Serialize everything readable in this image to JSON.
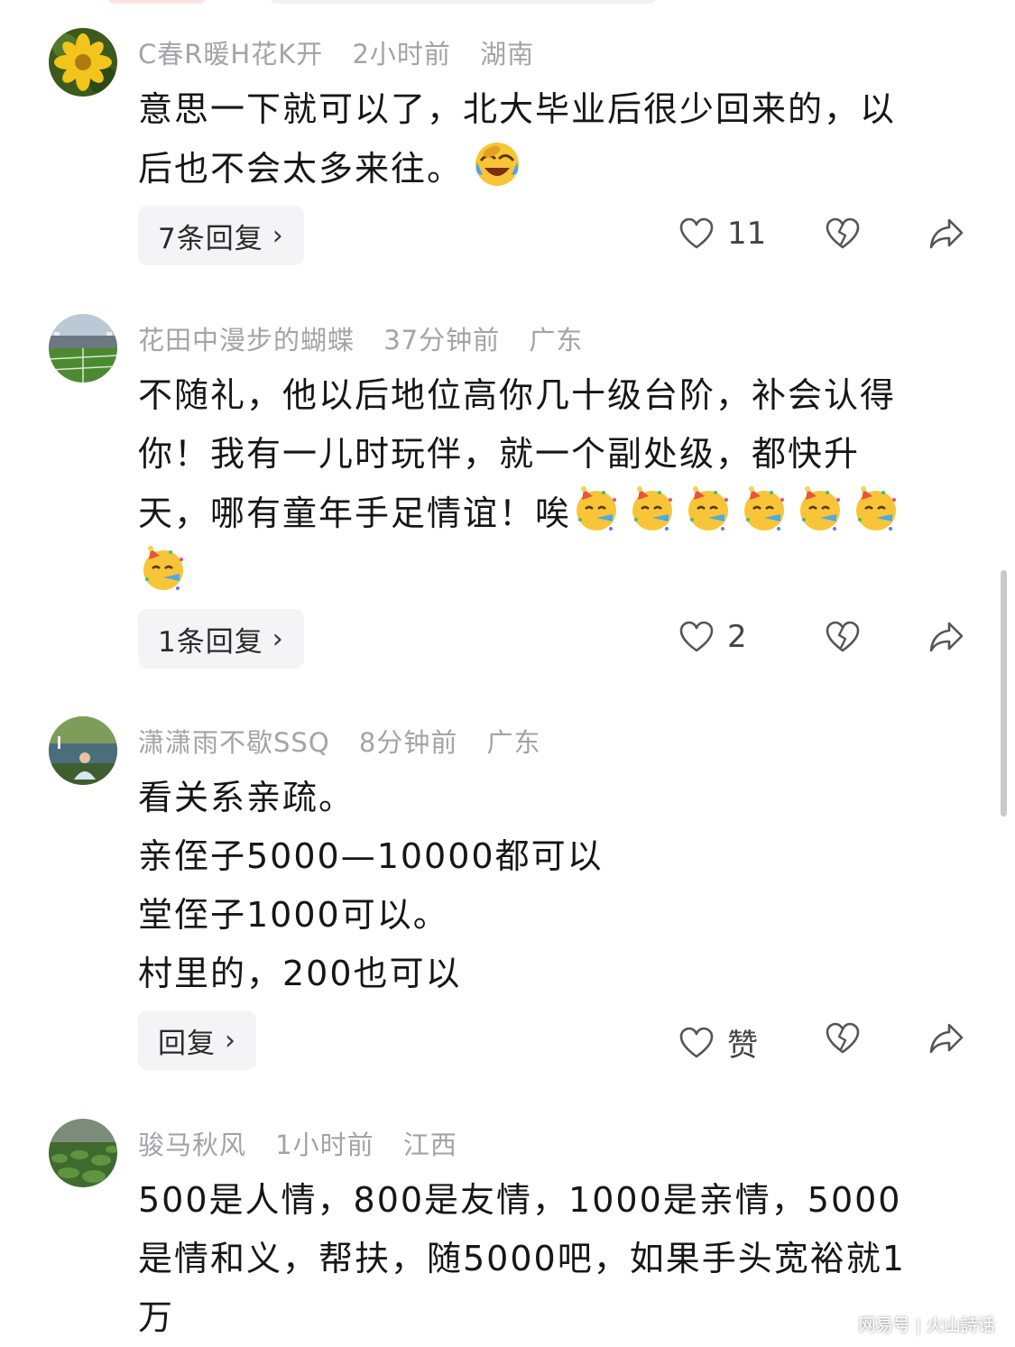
{
  "comments": [
    {
      "username": "C春R暖H花K开",
      "time": "2小时前",
      "location": "湖南",
      "lines": [
        "意思一下就可以了，北大毕业后很少回来的，以",
        "后也不会太多来往。"
      ],
      "reply_label": "7条回复",
      "like_count": "11",
      "avatar_icon": "flower-avatar",
      "emoji": "laughing-emoji"
    },
    {
      "username": "花田中漫步的蝴蝶",
      "time": "37分钟前",
      "location": "广东",
      "lines": [
        "不随礼，他以后地位高你几十级台阶，补会认得",
        "你！我有一儿时玩伴，就一个副处级，都快升",
        "天，哪有童年手足情谊！唉"
      ],
      "reply_label": "1条回复",
      "like_count": "2",
      "avatar_icon": "stadium-avatar",
      "emoji": "party-face-emoji"
    },
    {
      "username": "潇潇雨不歇SSQ",
      "time": "8分钟前",
      "location": "广东",
      "lines": [
        "看关系亲疏。",
        "亲侄子5000—10000都可以",
        "堂侄子1000可以。",
        "村里的，200也可以"
      ],
      "reply_label": "回复",
      "like_count": "赞",
      "avatar_icon": "man-lake-avatar"
    },
    {
      "username": "骏马秋风",
      "time": "1小时前",
      "location": "江西",
      "lines": [
        "500是人情，800是友情，1000是亲情，5000",
        "是情和义，帮扶，随5000吧，如果手头宽裕就1",
        "万"
      ],
      "avatar_icon": "lotus-field-avatar"
    }
  ],
  "icons": {
    "like": "heart-outline-icon",
    "dislike": "broken-heart-icon",
    "share": "share-arrow-icon",
    "chevron": "chevron-right-icon"
  },
  "watermark": {
    "left": "网易号",
    "right": "火山詩话"
  },
  "colors": {
    "meta_text": "#a3a3a8",
    "reply_bg": "#f4f4f6",
    "icon_stroke": "#555555"
  }
}
